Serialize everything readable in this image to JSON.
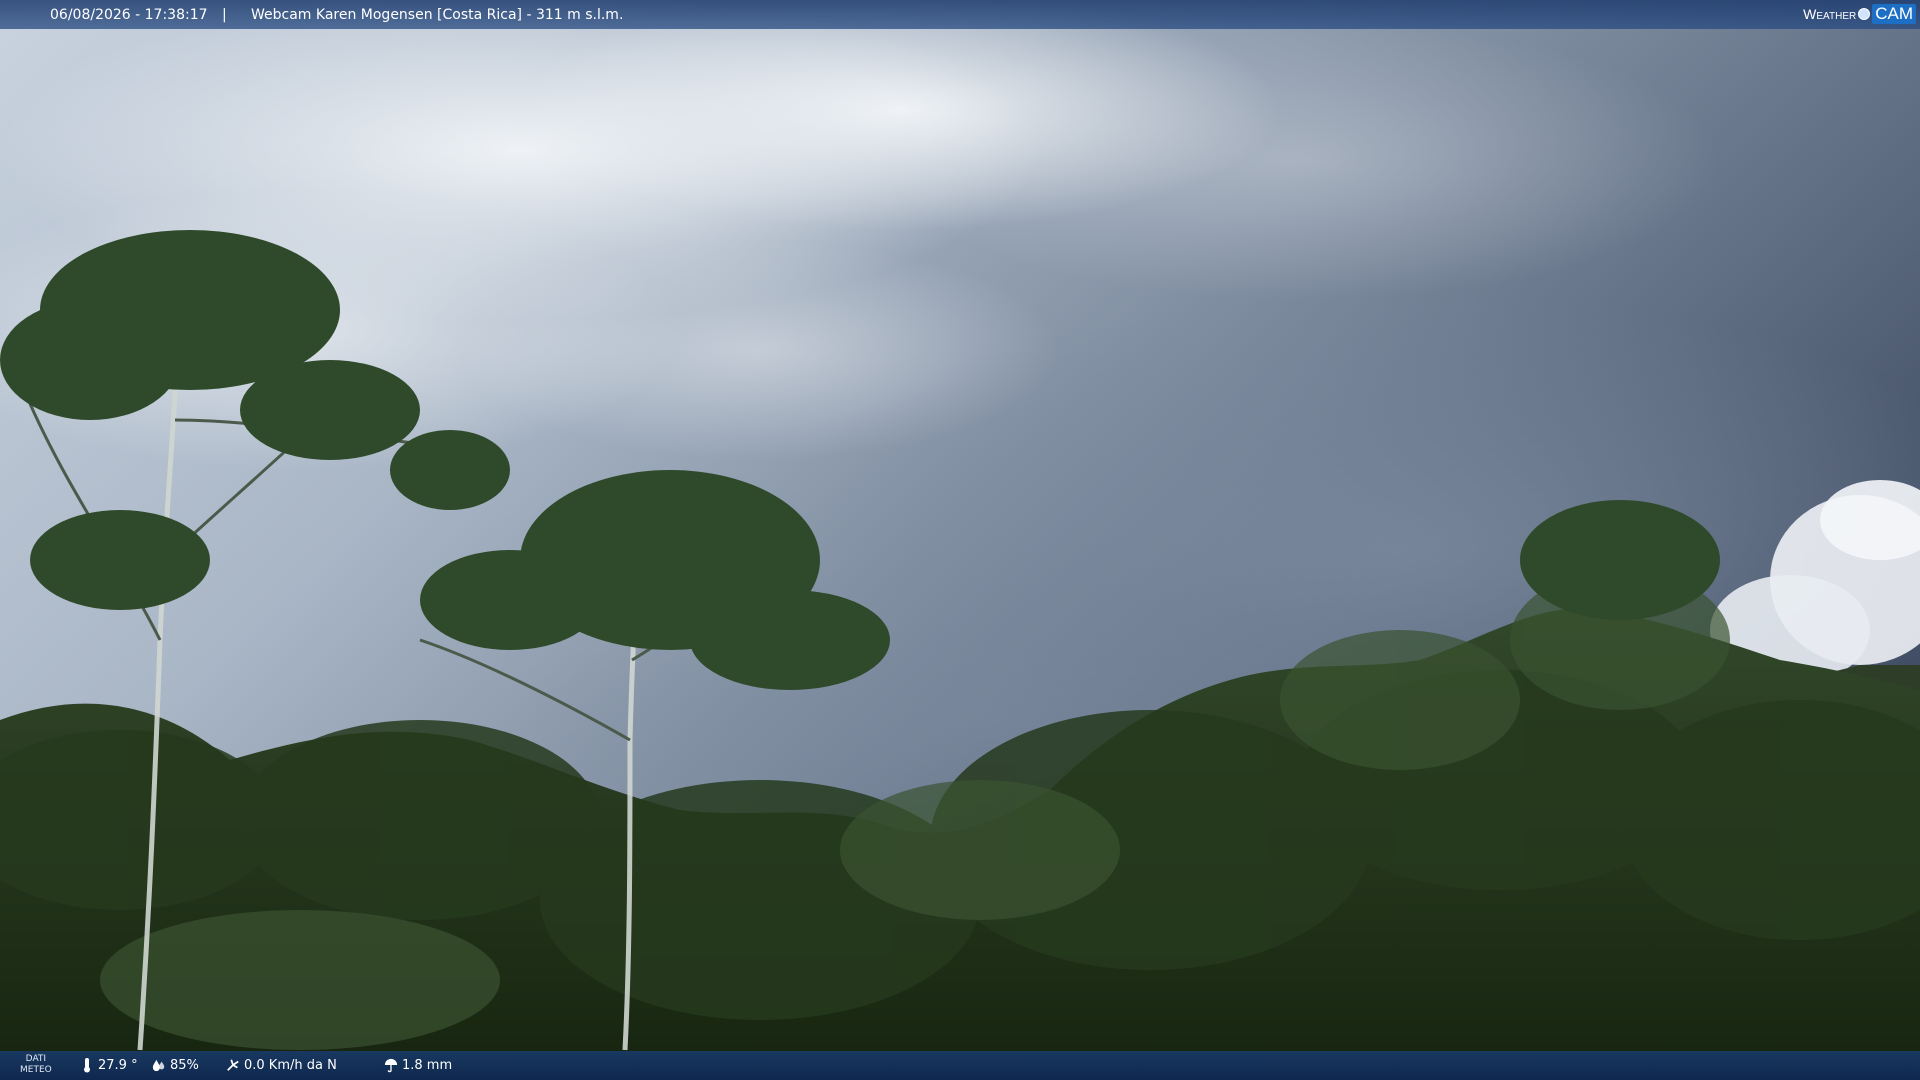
{
  "header": {
    "datetime": "06/08/2026 - 17:38:17",
    "separator": "|",
    "title": "Webcam Karen Mogensen [Costa Rica]  - 311 m s.l.m.",
    "logo_left": "Weather",
    "logo_right": "CAM"
  },
  "footer": {
    "dati_line1": "DATI",
    "dati_line2": "METEO",
    "temperature": "27.9 °",
    "humidity": "85%",
    "wind": "0.0 Km/h da N",
    "rain": "1.8 mm",
    "icons": [
      "thermometer-icon",
      "humidity-drop-icon",
      "wind-icon",
      "rain-umbrella-icon"
    ]
  },
  "colors": {
    "bar_blue": "#1e3c6e",
    "sky_light": "#dfe6ee",
    "sky_dark": "#3e4c62",
    "foliage": "#1f3118"
  }
}
